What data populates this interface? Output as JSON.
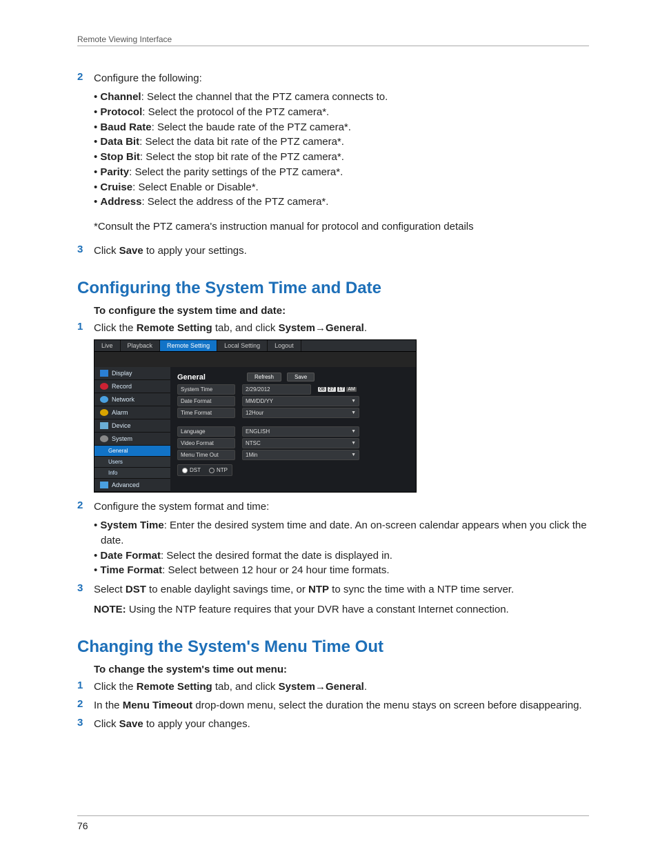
{
  "header": {
    "running_head": "Remote Viewing Interface"
  },
  "footer": {
    "page_number": "76"
  },
  "section1": {
    "step2": {
      "num": "2",
      "intro": "Configure the following:",
      "items": [
        {
          "term": "Channel",
          "desc": ": Select the channel that the PTZ camera connects to."
        },
        {
          "term": "Protocol",
          "desc": ": Select the protocol of the PTZ camera*."
        },
        {
          "term": "Baud Rate",
          "desc": ": Select the baude rate of the PTZ camera*."
        },
        {
          "term": "Data Bit",
          "desc": ": Select the data bit rate of the PTZ camera*."
        },
        {
          "term": "Stop Bit",
          "desc": ": Select the stop bit rate of the PTZ camera*."
        },
        {
          "term": "Parity",
          "desc": ": Select the parity settings of the PTZ camera*."
        },
        {
          "term": "Cruise",
          "desc": ": Select Enable or Disable*."
        },
        {
          "term": "Address",
          "desc": ": Select the address of the PTZ camera*."
        }
      ],
      "footnote": "*Consult the PTZ camera's instruction manual for protocol and configuration details"
    },
    "step3": {
      "num": "3",
      "pre": "Click ",
      "bold": "Save",
      "post": " to apply your settings."
    }
  },
  "section2": {
    "heading": "Configuring the System Time and Date",
    "subhead": "To configure the system time and date:",
    "step1": {
      "num": "1",
      "pre": "Click the ",
      "b1": "Remote Setting",
      "mid": " tab, and click ",
      "b2": "System",
      "arrow": "→",
      "b3": "General",
      "post": "."
    },
    "screenshot": {
      "tabs": {
        "live": "Live",
        "playback": "Playback",
        "remote": "Remote Setting",
        "local": "Local Setting",
        "logout": "Logout"
      },
      "sidebar": {
        "display": "Display",
        "record": "Record",
        "network": "Network",
        "alarm": "Alarm",
        "device": "Device",
        "system": "System",
        "general": "General",
        "users": "Users",
        "info": "Info",
        "advanced": "Advanced"
      },
      "panel": {
        "title": "General",
        "refresh": "Refresh",
        "save": "Save",
        "rows": {
          "system_time": {
            "label": "System Time",
            "value": "2/29/2012",
            "pills": [
              "08",
              "27",
              "17",
              "AM"
            ]
          },
          "date_format": {
            "label": "Date Format",
            "value": "MM/DD/YY"
          },
          "time_format": {
            "label": "Time Format",
            "value": "12Hour"
          },
          "language": {
            "label": "Language",
            "value": "ENGLISH"
          },
          "video_format": {
            "label": "Video Format",
            "value": "NTSC"
          },
          "menu_timeout": {
            "label": "Menu Time Out",
            "value": "1Min"
          }
        },
        "radios": {
          "dst": "DST",
          "ntp": "NTP"
        }
      }
    },
    "step2": {
      "num": "2",
      "intro": "Configure the system format and time:",
      "items": [
        {
          "term": "System Time",
          "desc": ": Enter the desired system time and date. An on-screen calendar appears when you click the date."
        },
        {
          "term": "Date Format",
          "desc": ": Select the desired format the date is displayed in."
        },
        {
          "term": "Time Format",
          "desc": ": Select between 12 hour or 24 hour time formats."
        }
      ]
    },
    "step3": {
      "num": "3",
      "pre": "Select ",
      "b1": "DST",
      "mid": " to enable daylight savings time, or ",
      "b2": "NTP",
      "post": " to sync the time with a NTP time server."
    },
    "note": {
      "label": "NOTE:",
      "text": " Using the NTP feature requires that your DVR have a constant Internet connection."
    }
  },
  "section3": {
    "heading": "Changing the System's Menu Time Out",
    "subhead": "To change the system's time out menu:",
    "step1": {
      "num": "1",
      "pre": "Click the ",
      "b1": "Remote Setting",
      "mid": " tab, and click ",
      "b2": "System",
      "arrow": "→",
      "b3": "General",
      "post": "."
    },
    "step2": {
      "num": "2",
      "pre": "In the ",
      "b1": "Menu Timeout",
      "post": " drop-down menu, select the duration the menu stays on screen before disappearing."
    },
    "step3": {
      "num": "3",
      "pre": "Click ",
      "b1": "Save",
      "post": " to apply your changes."
    }
  }
}
